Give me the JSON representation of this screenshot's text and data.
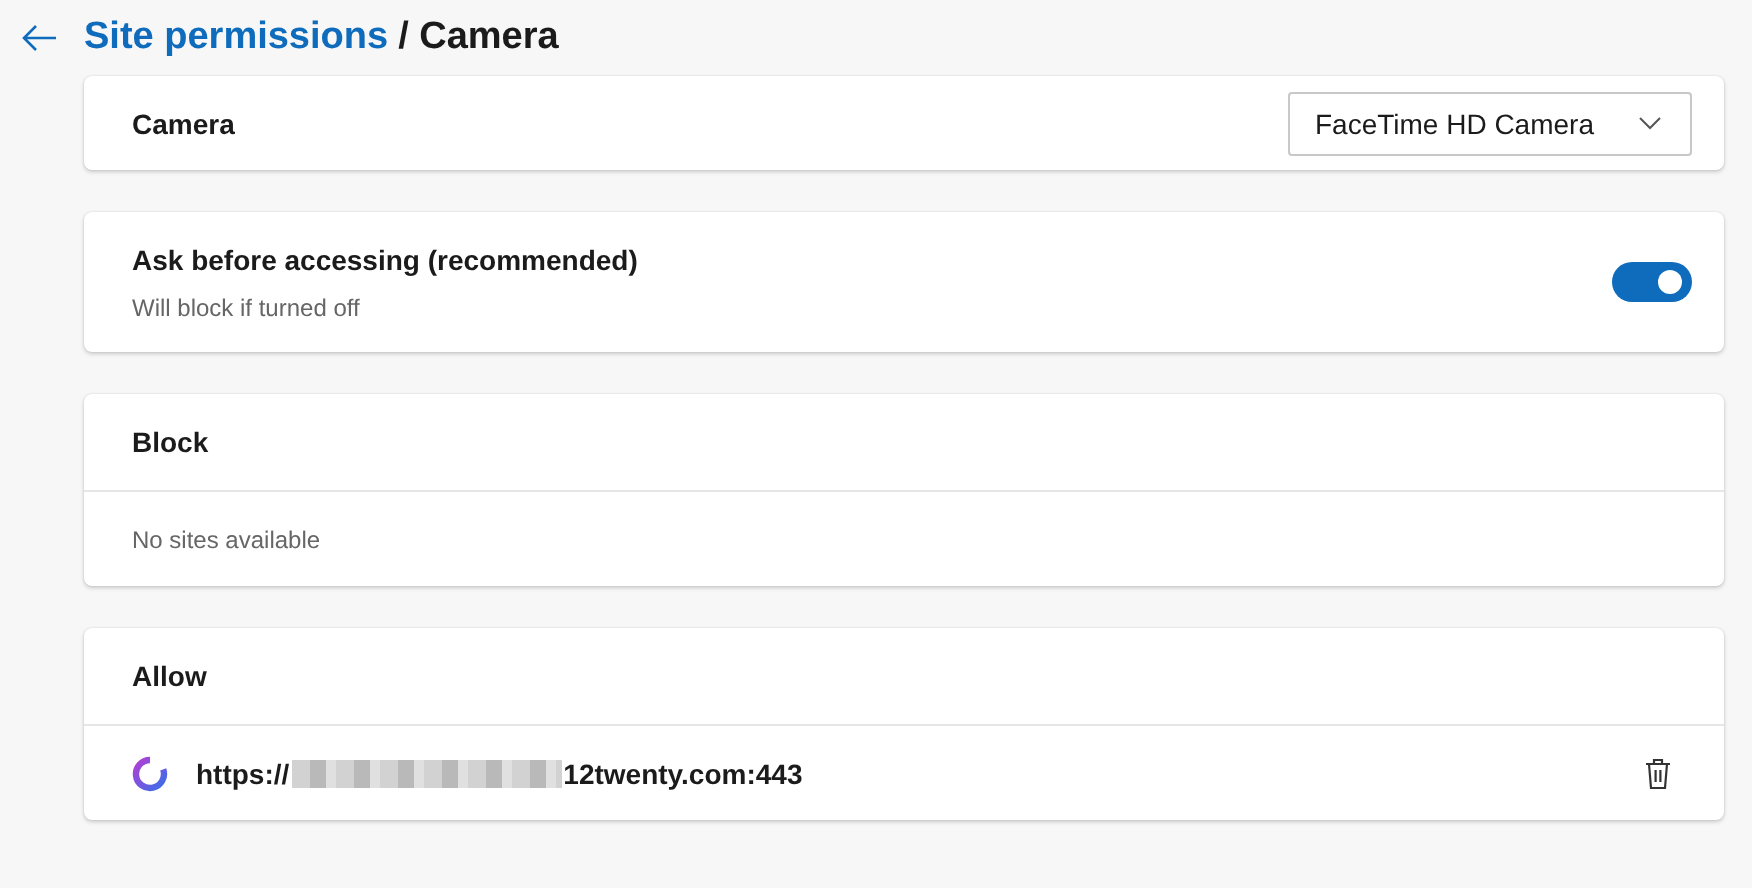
{
  "breadcrumb": {
    "parent": "Site permissions",
    "current": "/ Camera"
  },
  "device": {
    "label": "Camera",
    "value": "FaceTime HD Camera"
  },
  "ask": {
    "title": "Ask before accessing (recommended)",
    "subtitle": "Will block if turned off",
    "on": true
  },
  "lists": [
    {
      "title": "Block",
      "empty_text": "No sites available"
    },
    {
      "title": "Allow",
      "sites": [
        {
          "url_start": "https://",
          "redacted": true,
          "url_end": "12twenty.com:443"
        }
      ]
    }
  ]
}
